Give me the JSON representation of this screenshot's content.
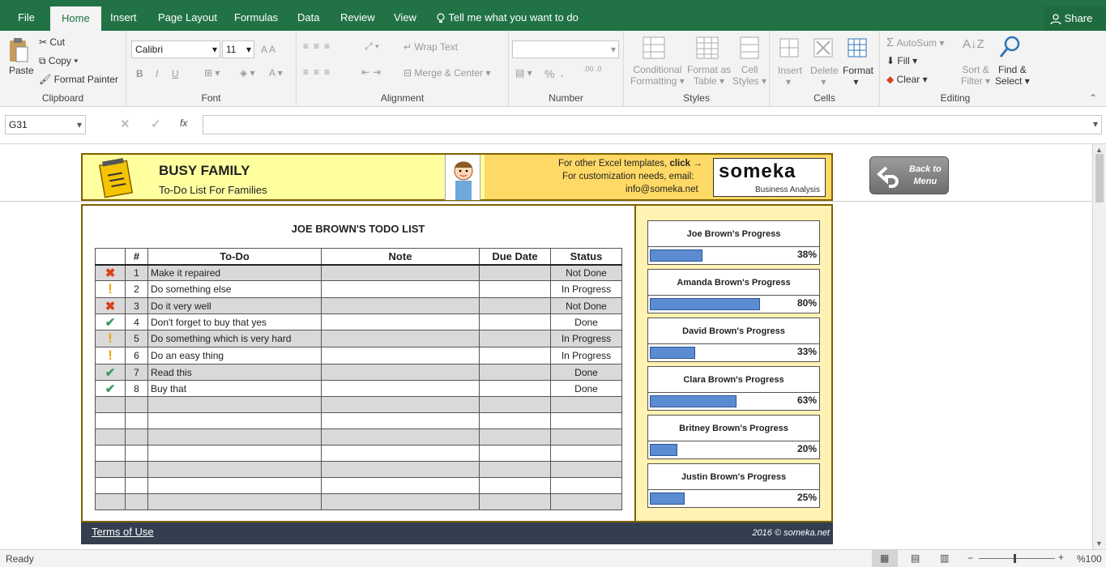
{
  "tabs": [
    "File",
    "Home",
    "Insert",
    "Page Layout",
    "Formulas",
    "Data",
    "Review",
    "View"
  ],
  "tell_me": "Tell me what you want to do",
  "share": "Share",
  "ribbon": {
    "clipboard": {
      "paste": "Paste",
      "cut": "Cut",
      "copy": "Copy",
      "format_painter": "Format Painter",
      "label": "Clipboard"
    },
    "font": {
      "name": "Calibri",
      "size": "11",
      "bold": "B",
      "italic": "I",
      "underline": "U",
      "label": "Font"
    },
    "alignment": {
      "wrap": "Wrap Text",
      "merge": "Merge & Center",
      "label": "Alignment"
    },
    "number": {
      "percent": "%",
      "label": "Number"
    },
    "styles": {
      "conditional": "Conditional",
      "conditional2": "Formatting",
      "format_as": "Format as",
      "format_as2": "Table",
      "cell": "Cell",
      "cell2": "Styles",
      "label": "Styles"
    },
    "cells": {
      "insert": "Insert",
      "delete": "Delete",
      "format": "Format",
      "label": "Cells"
    },
    "editing": {
      "autosum": "AutoSum",
      "fill": "Fill",
      "clear": "Clear",
      "sort": "Sort &",
      "sort2": "Filter",
      "find": "Find &",
      "find2": "Select",
      "label": "Editing"
    }
  },
  "namebox": "G31",
  "formula_icon": "fx",
  "header": {
    "title": "BUSY FAMILY",
    "subtitle": "To-Do List For Families",
    "templates": "For other Excel templates,",
    "click": "click →",
    "customization": "For customization needs, email:",
    "email": "info@someka.net",
    "logo": "someka",
    "logo_sub": "Business Analysis"
  },
  "back_button": {
    "line1": "Back to",
    "line2": "Menu"
  },
  "list_title": "JOE BROWN'S TODO LIST",
  "columns": [
    "#",
    "To-Do",
    "Note",
    "Due Date",
    "Status"
  ],
  "rows": [
    {
      "icon": "x",
      "num": "1",
      "todo": "Make it repaired",
      "status": "Not Done"
    },
    {
      "icon": "!",
      "num": "2",
      "todo": "Do something else",
      "status": "In Progress"
    },
    {
      "icon": "x",
      "num": "3",
      "todo": "Do it very well",
      "status": "Not Done"
    },
    {
      "icon": "check",
      "num": "4",
      "todo": "Don't forget to buy that yes",
      "status": "Done"
    },
    {
      "icon": "!",
      "num": "5",
      "todo": "Do something which is very hard",
      "status": "In Progress"
    },
    {
      "icon": "!",
      "num": "6",
      "todo": "Do an easy thing",
      "status": "In Progress"
    },
    {
      "icon": "check",
      "num": "7",
      "todo": "Read this",
      "status": "Done"
    },
    {
      "icon": "check",
      "num": "8",
      "todo": "Buy that",
      "status": "Done"
    }
  ],
  "progress": [
    {
      "name": "Joe Brown's Progress",
      "value": 38,
      "label": "38%"
    },
    {
      "name": "Amanda Brown's Progress",
      "value": 80,
      "label": "80%"
    },
    {
      "name": "David Brown's Progress",
      "value": 33,
      "label": "33%"
    },
    {
      "name": "Clara Brown's Progress",
      "value": 63,
      "label": "63%"
    },
    {
      "name": "Britney Brown's Progress",
      "value": 20,
      "label": "20%"
    },
    {
      "name": "Justin Brown's Progress",
      "value": 25,
      "label": "25%"
    }
  ],
  "footer": {
    "terms": "Terms of Use",
    "copyright": "2016 © someka.net"
  },
  "status": {
    "ready": "Ready",
    "zoom": "%100"
  },
  "colors": {
    "excel_green": "#217346",
    "header_yellow": "#ffffa0",
    "header_gold": "#ffd966",
    "bar_blue": "#5b8bd0",
    "footer_navy": "#333f4f",
    "icon_red": "#d9421c",
    "icon_orange": "#f0a30a",
    "icon_green": "#3c9a5f"
  }
}
